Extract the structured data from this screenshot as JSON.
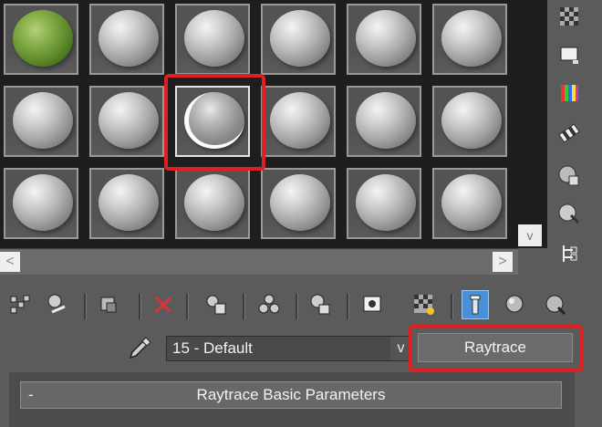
{
  "material_name": "15 - Default",
  "material_type": "Raytrace",
  "rollout": {
    "collapse_symbol": "-",
    "title": "Raytrace Basic Parameters"
  },
  "scroll_arrows": {
    "left": "<",
    "right": ">",
    "down": "v"
  },
  "dropdown_arrow": "v",
  "highlight_color": "#e02020",
  "slot_rows": [
    [
      "leaf",
      "gray",
      "gray",
      "gray",
      "gray",
      "gray"
    ],
    [
      "gray",
      "gray",
      "selected",
      "gray",
      "gray",
      "gray"
    ],
    [
      "gray",
      "gray",
      "gray",
      "gray",
      "gray",
      "gray"
    ]
  ],
  "side_toolbar_icons": [
    "sample-type-icon",
    "backlight-icon",
    "background-icon",
    "sample-uv-tiling-icon",
    "video-color-check-icon",
    "make-preview-icon",
    "options-icon",
    "select-by-material-icon"
  ],
  "bottom_toolbar_icons": [
    "get-material-icon",
    "put-to-scene-icon",
    "assign-to-selection-icon",
    "reset-map-icon",
    "make-unique-icon",
    "put-to-library-icon",
    "material-id-channel-icon",
    "show-in-viewport-icon",
    "show-end-result-icon",
    "go-to-parent-icon",
    "go-forward-sibling-icon",
    "material-map-navigator-icon"
  ]
}
